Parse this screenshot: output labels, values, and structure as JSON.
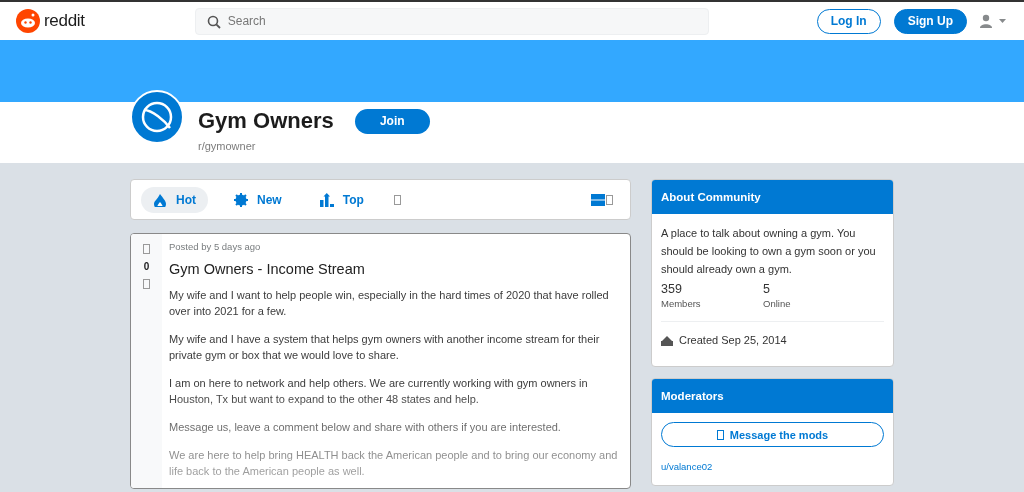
{
  "topbar": {
    "brand": "reddit",
    "search": {
      "placeholder": "Search"
    },
    "buttons": [
      {
        "label": "Log In",
        "kind": "outline"
      },
      {
        "label": "Sign Up",
        "kind": "filled"
      }
    ]
  },
  "community": {
    "name": "Gym Owners",
    "handle": "r/gymowner",
    "join": "Join"
  },
  "sort_tabs": [
    {
      "label": "Hot",
      "selected": true
    },
    {
      "label": "New",
      "selected": false
    },
    {
      "label": "Top",
      "selected": false
    }
  ],
  "post": {
    "score": "0",
    "meta": "Posted by 5 days ago",
    "title": "Gym Owners - Income Stream",
    "paragraphs": [
      "My wife and I want to help people win, especially in the hard times of 2020 that have rolled over into 2021 for a few.",
      "My wife and I have a system that helps gym owners with another income stream for their private gym or box that we would love to share.",
      "I am on here to network and help others. We are currently working with gym owners in Houston, Tx but want to expand to the other 48 states and help.",
      "Message us, leave a comment below and share with others if you are interested.",
      "We are here to help bring HEALTH back the American people and to bring our economy and life back to the American people as well."
    ]
  },
  "about": {
    "title": "About Community",
    "description": "A place to talk about owning a gym. You should be looking to own a gym soon or you should already own a gym.",
    "stats": [
      {
        "value": "359",
        "label": "Members"
      },
      {
        "value": "5",
        "label": "Online"
      }
    ],
    "created": "Created Sep 25, 2014"
  },
  "moderators": {
    "title": "Moderators",
    "message_button": "Message the mods",
    "users": [
      "u/valance02"
    ]
  }
}
